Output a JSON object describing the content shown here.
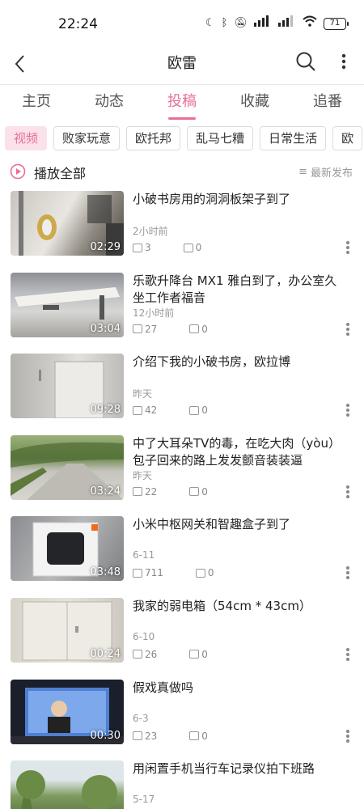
{
  "status": {
    "time": "22:24",
    "battery": "71"
  },
  "header": {
    "title": "欧雷"
  },
  "tabs": [
    "主页",
    "动态",
    "投稿",
    "收藏",
    "追番"
  ],
  "chips": [
    "视频",
    "败家玩意",
    "欧托邦",
    "乱马七糟",
    "日常生活",
    "欧"
  ],
  "playall": {
    "label": "播放全部",
    "sort": "最新发布"
  },
  "videos": [
    {
      "title": "小破书房用的洞洞板架子到了",
      "time": "2小时前",
      "plays": "3",
      "comments": "0",
      "duration": "02:29"
    },
    {
      "title": "乐歌升降台 MX1 雅白到了，办公室久坐工作者福音",
      "time": "12小时前",
      "plays": "27",
      "comments": "0",
      "duration": "03:04"
    },
    {
      "title": "介绍下我的小破书房，欧拉博",
      "time": "昨天",
      "plays": "42",
      "comments": "0",
      "duration": "09:28"
    },
    {
      "title": "中了大耳朵TV的毒，在吃大肉（yòu）包子回来的路上发发颤音装装逼",
      "time": "昨天",
      "plays": "22",
      "comments": "0",
      "duration": "03:24"
    },
    {
      "title": "小米中枢网关和智趣盒子到了",
      "time": "6-11",
      "plays": "711",
      "comments": "0",
      "duration": "03:48"
    },
    {
      "title": "我家的弱电箱（54cm * 43cm）",
      "time": "6-10",
      "plays": "26",
      "comments": "0",
      "duration": "00:24"
    },
    {
      "title": "假戏真做吗",
      "time": "6-3",
      "plays": "23",
      "comments": "0",
      "duration": "00:30"
    },
    {
      "title": "用闲置手机当行车记录仪拍下班路",
      "time": "5-17",
      "plays": "",
      "comments": "",
      "duration": ""
    }
  ],
  "colors": {
    "accent": "#e76f99"
  }
}
